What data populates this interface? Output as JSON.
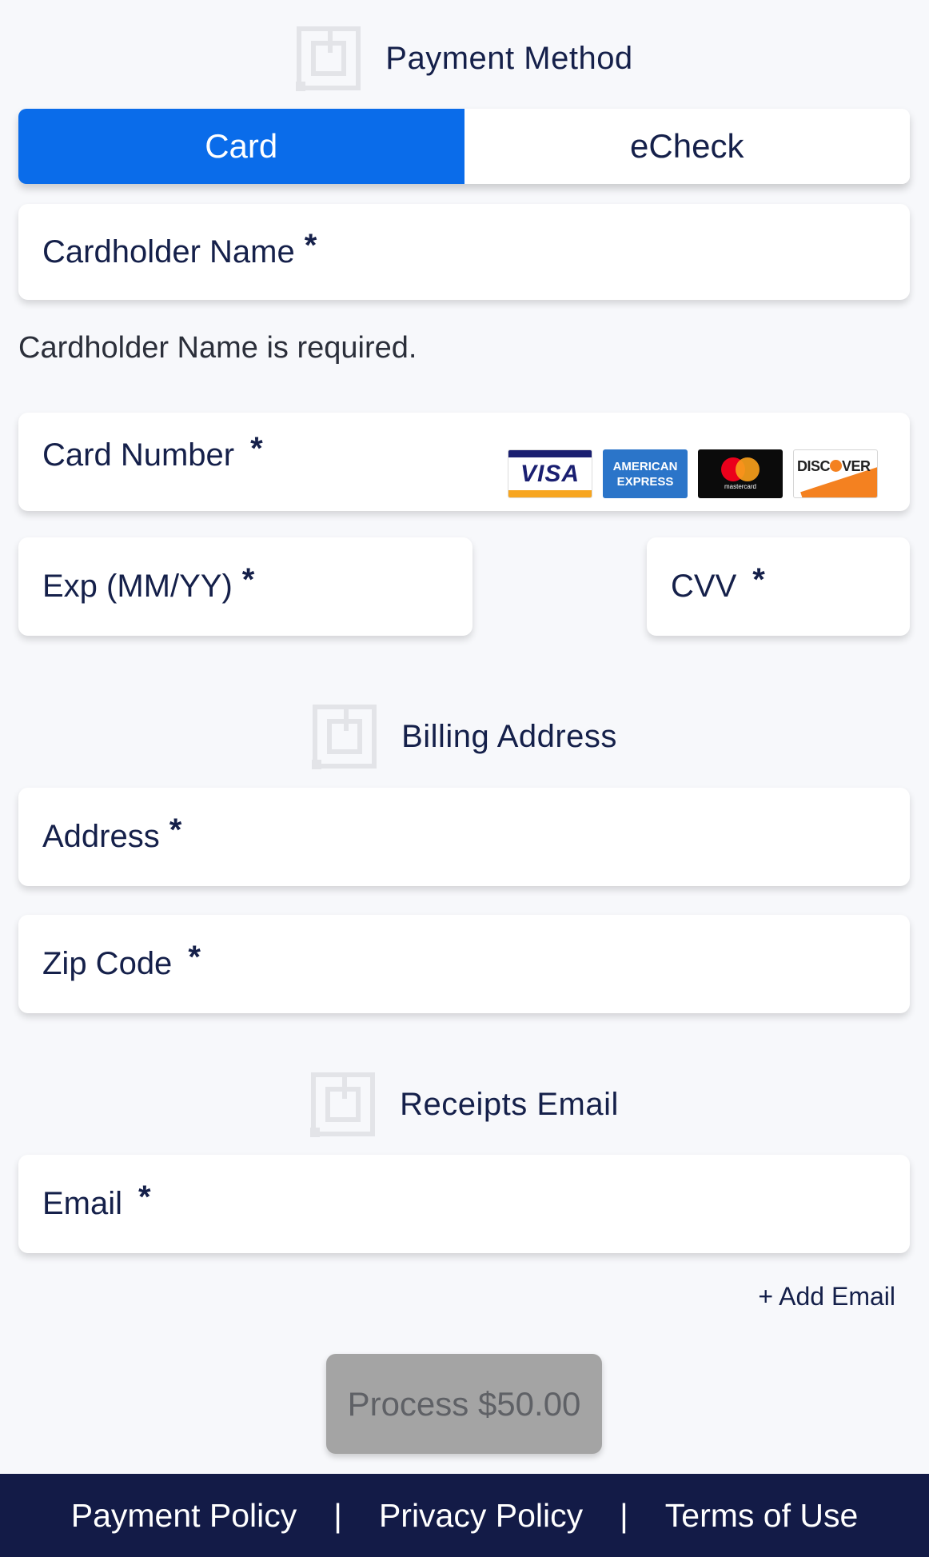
{
  "payment_method": {
    "title": "Payment Method",
    "icon": "form-section-icon",
    "tabs": [
      {
        "label": "Card",
        "active": true
      },
      {
        "label": "eCheck",
        "active": false
      }
    ]
  },
  "card_form": {
    "cardholder_name": {
      "label": "Cardholder Name",
      "required": "*"
    },
    "cardholder_error": "Cardholder Name is required.",
    "card_number": {
      "label": "Card Number",
      "required": "*"
    },
    "card_brands": [
      {
        "name": "visa",
        "text": "VISA"
      },
      {
        "name": "american-express",
        "text_line1": "AMERICAN",
        "text_line2": "EXPRESS"
      },
      {
        "name": "mastercard",
        "text": "mastercard"
      },
      {
        "name": "discover",
        "text_pre": "DISC",
        "text_post": "VER"
      }
    ],
    "exp": {
      "label": "Exp (MM/YY)",
      "required": "*"
    },
    "cvv": {
      "label": "CVV",
      "required": "*"
    }
  },
  "billing_address": {
    "title": "Billing Address",
    "address": {
      "label": "Address",
      "required": "*"
    },
    "zip": {
      "label": "Zip Code",
      "required": "*"
    }
  },
  "receipts_email": {
    "title": "Receipts Email",
    "email": {
      "label": "Email",
      "required": "*"
    },
    "add_email": "+ Add Email"
  },
  "process_button": {
    "label": "Process $50.00"
  },
  "footer": {
    "links": [
      "Payment Policy",
      "Privacy Policy",
      "Terms of Use"
    ],
    "separator": "|"
  },
  "colors": {
    "accent": "#0a6cea",
    "text": "#15204a",
    "footer_bg": "#131b47",
    "disabled_button": "#a4a4a4"
  }
}
